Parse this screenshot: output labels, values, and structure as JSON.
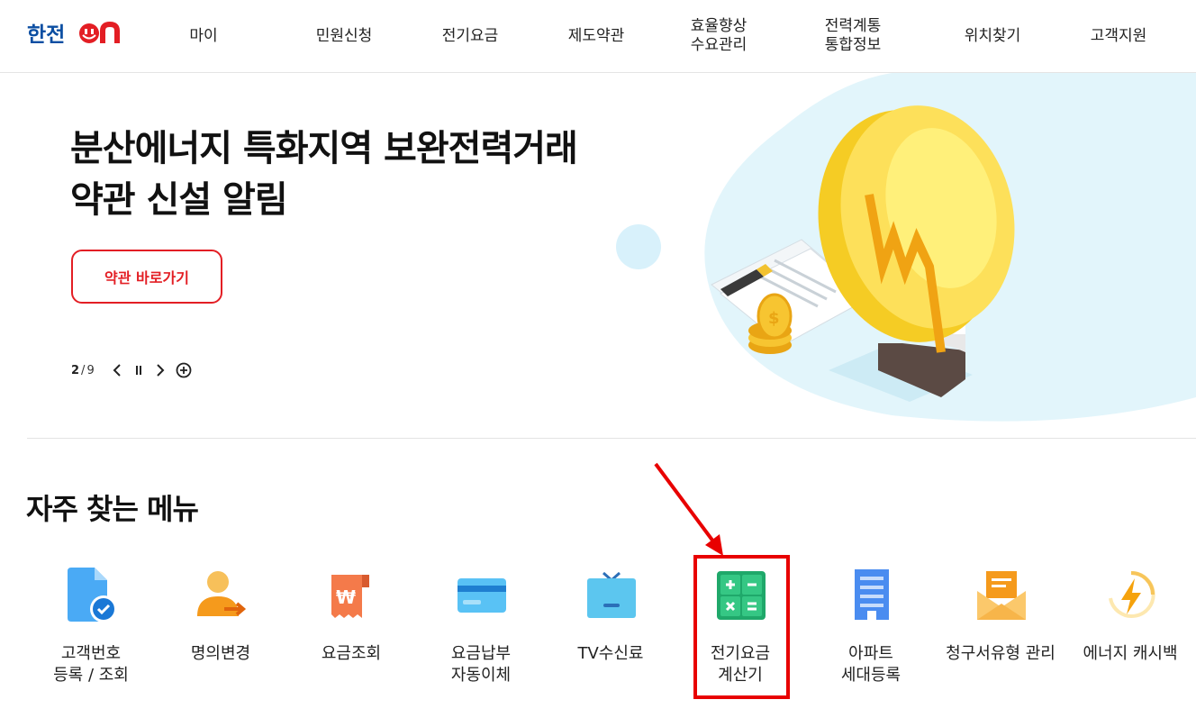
{
  "header": {
    "logo_text": "한전ON",
    "nav": [
      {
        "id": "my",
        "label": "마이"
      },
      {
        "id": "civil",
        "label": "민원신청"
      },
      {
        "id": "bill",
        "label": "전기요금"
      },
      {
        "id": "terms",
        "label": "제도약관"
      },
      {
        "id": "efficiency",
        "label": "효율향상\n수요관리"
      },
      {
        "id": "grid",
        "label": "전력계통\n통합정보"
      },
      {
        "id": "location",
        "label": "위치찾기"
      },
      {
        "id": "support",
        "label": "고객지원"
      }
    ]
  },
  "hero": {
    "title": "분산에너지 특화지역 보완전력거래\n약관 신설 알림",
    "button_label": "약관 바로가기",
    "pager": {
      "current": "2",
      "separator": "/",
      "total": "9"
    }
  },
  "quick_menu": {
    "title": "자주 찾는 메뉴",
    "items": [
      {
        "id": "customer-number",
        "label": "고객번호\n등록 / 조회",
        "icon": "document-check-icon"
      },
      {
        "id": "name-change",
        "label": "명의변경",
        "icon": "person-transfer-icon"
      },
      {
        "id": "bill-inquiry",
        "label": "요금조회",
        "icon": "won-receipt-icon"
      },
      {
        "id": "auto-payment",
        "label": "요금납부\n자동이체",
        "icon": "credit-card-icon"
      },
      {
        "id": "tv-fee",
        "label": "TV수신료",
        "icon": "tv-icon"
      },
      {
        "id": "bill-calculator",
        "label": "전기요금\n계산기",
        "icon": "calculator-icon"
      },
      {
        "id": "apartment",
        "label": "아파트\n세대등록",
        "icon": "apartment-building-icon"
      },
      {
        "id": "bill-type",
        "label": "청구서유형 관리",
        "icon": "envelope-icon"
      },
      {
        "id": "cashback",
        "label": "에너지 캐시백",
        "icon": "lightning-cycle-icon"
      }
    ]
  },
  "colors": {
    "accent_red": "#e31e24",
    "brand_blue": "#0b4ea2",
    "highlight_red": "#e80000"
  }
}
